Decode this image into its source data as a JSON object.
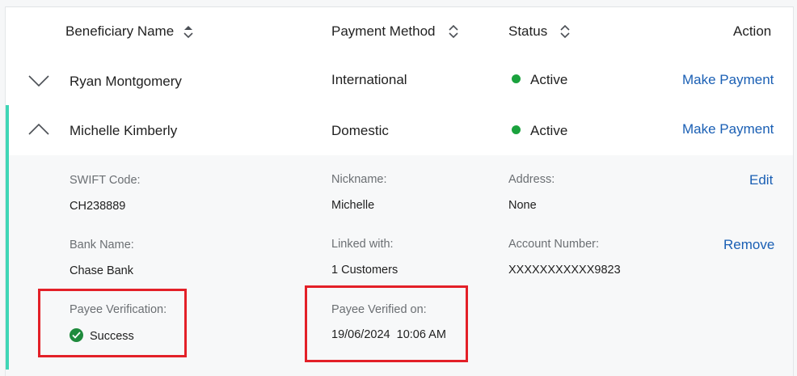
{
  "header": {
    "beneficiary_name": "Beneficiary Name",
    "payment_method": "Payment Method",
    "status": "Status",
    "action": "Action"
  },
  "rows": [
    {
      "name": "Ryan Montgomery",
      "method": "International",
      "status": "Active",
      "action": "Make Payment",
      "expanded": false
    },
    {
      "name": "Michelle Kimberly",
      "method": "Domestic",
      "status": "Active",
      "action": "Make Payment",
      "expanded": true
    }
  ],
  "details": {
    "swift_label": "SWIFT Code:",
    "swift_value": "CH238889",
    "nickname_label": "Nickname:",
    "nickname_value": "Michelle",
    "address_label": "Address:",
    "address_value": "None",
    "bank_label": "Bank Name:",
    "bank_value": "Chase Bank",
    "linked_label": "Linked with:",
    "linked_value": "1 Customers",
    "account_label": "Account Number:",
    "account_value": "XXXXXXXXXXX9823",
    "payee_verification_label": "Payee Verification:",
    "payee_verification_value": "Success",
    "payee_verified_on_label": "Payee Verified on:",
    "payee_verified_on_value": "19/06/2024  10:06 AM",
    "edit_label": "Edit",
    "remove_label": "Remove"
  },
  "colors": {
    "accent": "#3fd6b6",
    "link": "#1a5fb4",
    "status_active": "#1aa23d",
    "highlight_box": "#e32028"
  }
}
